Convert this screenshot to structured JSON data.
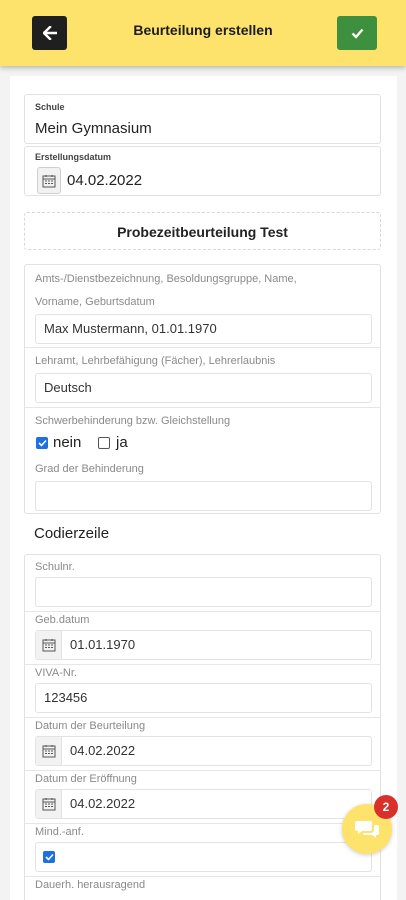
{
  "header": {
    "title": "Beurteilung erstellen",
    "back_icon": "arrow-left-icon",
    "confirm_icon": "check-icon",
    "bar_color": "#fde36b",
    "confirm_color": "#3e8f3e"
  },
  "school": {
    "label": "Schule",
    "value": "Mein Gymnasium"
  },
  "created": {
    "label": "Erstellungsdatum",
    "value": "04.02.2022"
  },
  "template_heading": "Probezeitbeurteilung Test",
  "person": {
    "label_line1": "Amts-/Dienstbezeichnung, Besoldungsgruppe, Name,",
    "label_line2": "Vorname, Geburtsdatum",
    "value": "Max Mustermann, 01.01.1970"
  },
  "teaching": {
    "label": "Lehramt, Lehrbefähigung (Fächer), Lehrerlaubnis",
    "value": "Deutsch"
  },
  "disability": {
    "label": "Schwerbehinderung bzw. Gleichstellung",
    "option_no": "nein",
    "option_no_checked": true,
    "option_yes": "ja",
    "option_yes_checked": false,
    "degree_label": "Grad der Behinderung",
    "degree_value": ""
  },
  "coding": {
    "title": "Codierzeile",
    "school_no_label": "Schulnr.",
    "school_no_value": "",
    "birth_label": "Geb.datum",
    "birth_value": "01.01.1970",
    "viva_label": "VIVA-Nr.",
    "viva_value": "123456",
    "review_date_label": "Datum der Beurteilung",
    "review_date_value": "04.02.2022",
    "opening_date_label": "Datum der Eröffnung",
    "opening_date_value": "04.02.2022",
    "min_req_label": "Mind.-anf.",
    "min_req_checked": true,
    "next_label": "Dauerh. herausragend"
  },
  "chat": {
    "icon": "chat-bubbles-icon",
    "badge_count": "2"
  }
}
